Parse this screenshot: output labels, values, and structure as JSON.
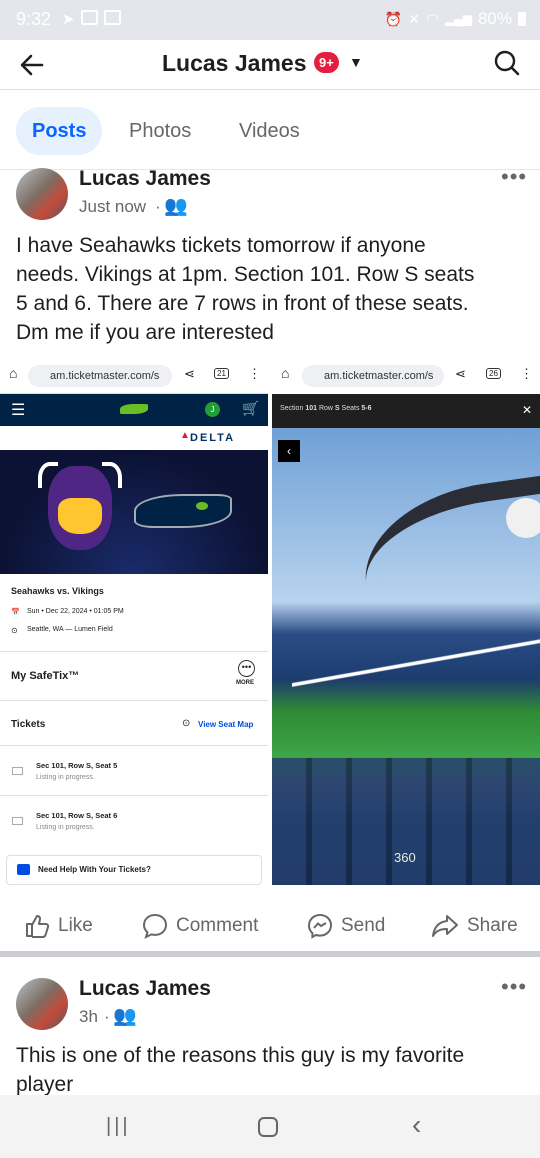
{
  "status_bar": {
    "time": "9:32",
    "battery": "80%"
  },
  "header": {
    "title": "Lucas James",
    "badge": "9+"
  },
  "tabs": [
    {
      "label": "Posts"
    },
    {
      "label": "Photos"
    },
    {
      "label": "Videos"
    }
  ],
  "post1": {
    "author": "Lucas James",
    "time": "Just now",
    "text_lines": [
      "I have Seahawks tickets tomorrow if anyone",
      "needs. Vikings at 1pm. Section 101. Row S seats",
      "5 and 6. There are 7 rows in front of these seats.",
      "Dm me if you are interested"
    ]
  },
  "screenshot_left": {
    "url": "am.ticketmaster.com/s",
    "tab_count": "21",
    "sponsor": "DELTA",
    "event": "Seahawks vs. Vikings",
    "date": "Sun • Dec 22, 2024 • 01:05 PM",
    "venue": "Seattle, WA — Lumen Field",
    "safetix": "My SafeTix™",
    "more": "MORE",
    "tickets_label": "Tickets",
    "seat_map": "View Seat Map",
    "ticket1": "Sec 101, Row S, Seat 5",
    "ticket1_status": "Listing in progress.",
    "ticket2": "Sec 101, Row S, Seat 6",
    "ticket2_status": "Listing in progress.",
    "help": "Need Help With Your Tickets?",
    "avatar_letter": "J"
  },
  "screenshot_right": {
    "url": "am.ticketmaster.com/s",
    "tab_count": "26",
    "seat_info_prefix": "Section",
    "section": "101",
    "row_label": "Row",
    "row": "S",
    "seats_label": "Seats",
    "seats": "5-6",
    "view_360": "360"
  },
  "actions": {
    "like": "Like",
    "comment": "Comment",
    "send": "Send",
    "share": "Share"
  },
  "post2": {
    "author": "Lucas James",
    "time": "3h",
    "text_lines": [
      "This is one of the reasons this guy is my favorite",
      "player"
    ]
  },
  "colors": {
    "fb_blue": "#0866ff",
    "seahawks_navy": "#002244",
    "vikings_purple": "#4f2683",
    "badge_red": "#e41e3f"
  }
}
